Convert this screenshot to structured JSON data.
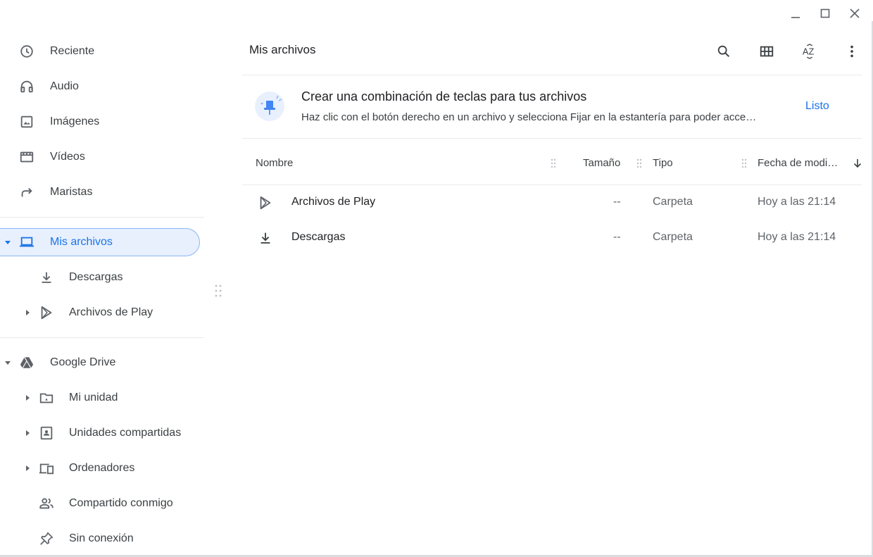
{
  "window_controls": [
    "minimize",
    "maximize",
    "close"
  ],
  "sidebar": {
    "recents": [
      {
        "label": "Reciente",
        "icon": "clock-icon"
      },
      {
        "label": "Audio",
        "icon": "headphones-icon"
      },
      {
        "label": "Imágenes",
        "icon": "image-icon"
      },
      {
        "label": "Vídeos",
        "icon": "film-icon"
      },
      {
        "label": "Maristas",
        "icon": "share-arrow-icon"
      }
    ],
    "my_files": {
      "label": "Mis archivos",
      "icon": "laptop-icon"
    },
    "my_files_children": [
      {
        "label": "Descargas",
        "icon": "download-icon"
      },
      {
        "label": "Archivos de Play",
        "icon": "play-store-icon"
      }
    ],
    "drive": {
      "label": "Google Drive",
      "icon": "drive-icon"
    },
    "drive_children": [
      {
        "label": "Mi unidad",
        "icon": "my-drive-icon"
      },
      {
        "label": "Unidades compartidas",
        "icon": "shared-drives-icon"
      },
      {
        "label": "Ordenadores",
        "icon": "computers-icon"
      },
      {
        "label": "Compartido conmigo",
        "icon": "people-icon"
      },
      {
        "label": "Sin conexión",
        "icon": "pin-icon"
      }
    ]
  },
  "main": {
    "title": "Mis archivos",
    "toolbar": [
      "search-icon",
      "grid-view-icon",
      "sort-az-icon",
      "more-vert-icon"
    ],
    "sort_label": "AZ",
    "banner": {
      "title": "Crear una combinación de teclas para tus archivos",
      "text": "Haz clic con el botón derecho en un archivo y selecciona Fijar en la estantería para poder acceder rápidamente a él.",
      "button": "Listo"
    },
    "columns": {
      "name": "Nombre",
      "size": "Tamaño",
      "type": "Tipo",
      "date": "Fecha de modi…"
    },
    "rows": [
      {
        "name": "Archivos de Play",
        "size": "--",
        "type": "Carpeta",
        "date": "Hoy a las 21:14",
        "icon": "play-store-icon"
      },
      {
        "name": "Descargas",
        "size": "--",
        "type": "Carpeta",
        "date": "Hoy a las 21:14",
        "icon": "download-icon"
      }
    ]
  },
  "colors": {
    "accent": "#1a73e8",
    "selected_bg": "#e8f0fe",
    "selected_border": "#8ab4f8",
    "text": "#3c4043"
  }
}
